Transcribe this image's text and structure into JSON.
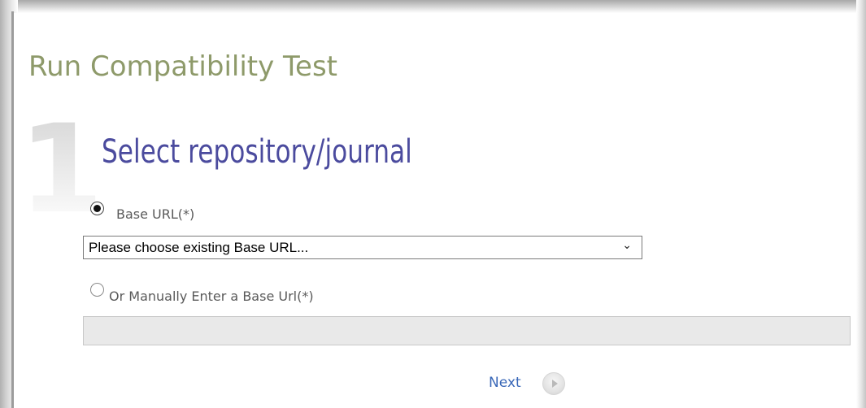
{
  "page": {
    "title": "Run Compatibility Test"
  },
  "step": {
    "number": "1",
    "title": "Select repository/journal"
  },
  "form": {
    "base_url_option": {
      "label": "Base URL(*)",
      "selected": true
    },
    "base_url_select": {
      "value": "Please choose existing Base URL...",
      "arrow_icon": "chevron-down-icon"
    },
    "manual_option": {
      "label": "Or Manually Enter a Base Url(*)",
      "selected": false
    },
    "manual_input": {
      "value": "",
      "disabled": true
    },
    "next": {
      "label": "Next",
      "icon": "play-circle-icon"
    }
  },
  "colors": {
    "page_title": "#8e9a6a",
    "step_title": "#4b4b9e",
    "link": "#3a68b8",
    "disabled_input": "#e9e9e9"
  }
}
